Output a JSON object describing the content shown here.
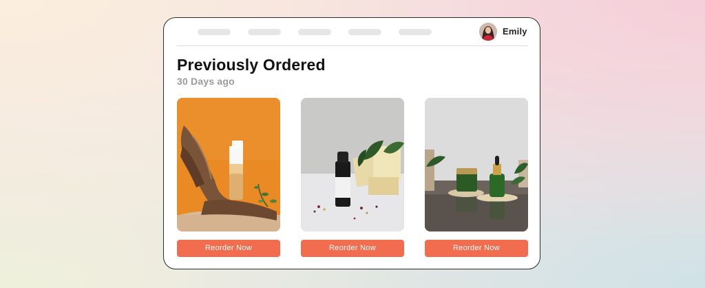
{
  "header": {
    "nav_items": [
      "",
      "",
      "",
      "",
      ""
    ],
    "user": {
      "name": "Emily",
      "avatar_icon": "user-avatar"
    }
  },
  "section": {
    "title": "Previously Ordered",
    "subtitle": "30 Days ago"
  },
  "products": [
    {
      "image": "orange-backdrop-serum-pump-bottle",
      "button_label": "Reorder Now"
    },
    {
      "image": "black-dropper-bottle-with-soap-bars",
      "button_label": "Reorder Now"
    },
    {
      "image": "green-glass-serum-and-cream-jar",
      "button_label": "Reorder Now"
    }
  ],
  "colors": {
    "accent": "#f26d4f",
    "card_border": "#2a2a2a",
    "nav_placeholder": "#e6e6e6",
    "subtitle": "#9a9a9a"
  }
}
